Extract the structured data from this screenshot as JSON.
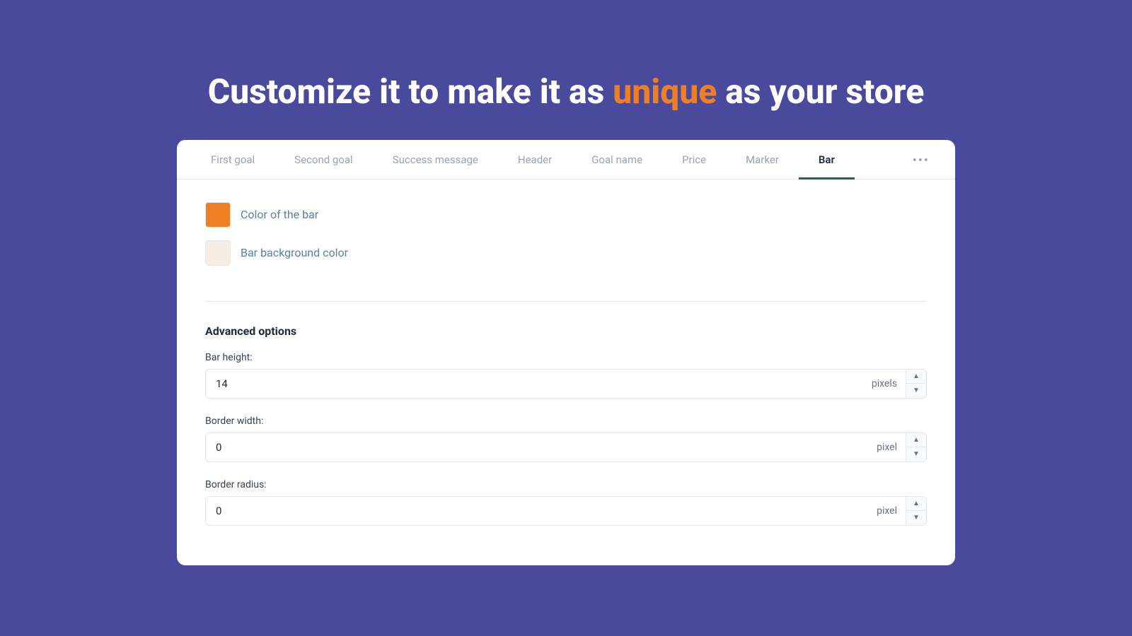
{
  "headline": {
    "before": "Customize it to make it as",
    "highlight": "unique",
    "after": "as your store"
  },
  "tabs": [
    {
      "id": "first-goal",
      "label": "First goal",
      "active": false
    },
    {
      "id": "second-goal",
      "label": "Second goal",
      "active": false
    },
    {
      "id": "success-message",
      "label": "Success message",
      "active": false
    },
    {
      "id": "header",
      "label": "Header",
      "active": false
    },
    {
      "id": "goal-name",
      "label": "Goal name",
      "active": false
    },
    {
      "id": "price",
      "label": "Price",
      "active": false
    },
    {
      "id": "marker",
      "label": "Marker",
      "active": false
    },
    {
      "id": "bar",
      "label": "Bar",
      "active": true
    }
  ],
  "more_label": "•••",
  "colors": {
    "bar_color_label": "Color of the bar",
    "bar_color_value": "#f07f23",
    "bg_color_label": "Bar background color",
    "bg_color_value": "#f5ede3"
  },
  "advanced": {
    "section_title": "Advanced options",
    "fields": [
      {
        "id": "bar-height",
        "label": "Bar height:",
        "value": "14",
        "unit": "pixels"
      },
      {
        "id": "border-width",
        "label": "Border width:",
        "value": "0",
        "unit": "pixel"
      },
      {
        "id": "border-radius",
        "label": "Border radius:",
        "value": "0",
        "unit": "pixel"
      }
    ]
  }
}
